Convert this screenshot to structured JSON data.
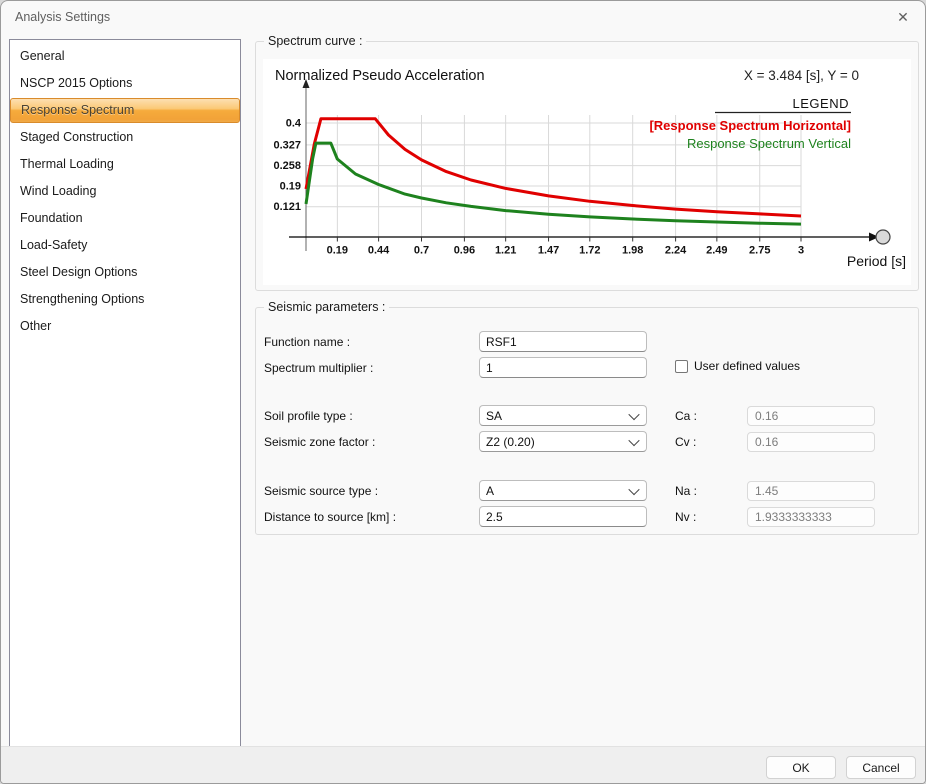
{
  "window": {
    "title": "Analysis Settings",
    "close_icon": "✕"
  },
  "sidebar": {
    "items": [
      {
        "label": "General",
        "selected": false
      },
      {
        "label": "NSCP 2015 Options",
        "selected": false
      },
      {
        "label": "Response Spectrum",
        "selected": true
      },
      {
        "label": "Staged Construction",
        "selected": false
      },
      {
        "label": "Thermal Loading",
        "selected": false
      },
      {
        "label": "Wind Loading",
        "selected": false
      },
      {
        "label": "Foundation",
        "selected": false
      },
      {
        "label": "Load-Safety",
        "selected": false
      },
      {
        "label": "Steel Design Options",
        "selected": false
      },
      {
        "label": "Strengthening Options",
        "selected": false
      },
      {
        "label": "Other",
        "selected": false
      }
    ]
  },
  "spectrum_group": {
    "title": "Spectrum curve :"
  },
  "chart_data": {
    "type": "line",
    "title": "Normalized Pseudo Acceleration",
    "cursor_readout": "X = 3.484 [s],  Y = 0",
    "legend_title": "LEGEND",
    "xlabel": "Period [s]",
    "ylabel": "Normalized Pseudo Acceleration",
    "xlim": [
      0,
      3.3
    ],
    "ylim": [
      0,
      0.48
    ],
    "grid": true,
    "legend_position": "top-right",
    "x_ticks": {
      "values": [
        0.19,
        0.44,
        0.7,
        0.96,
        1.21,
        1.47,
        1.72,
        1.98,
        2.24,
        2.49,
        2.75,
        3
      ],
      "labels": [
        "0.19",
        "0.44",
        "0.7",
        "0.96",
        "1.21",
        "1.47",
        "1.72",
        "1.98",
        "2.24",
        "2.49",
        "2.75",
        "3"
      ]
    },
    "y_ticks": {
      "values": [
        0.4,
        0.327,
        0.258,
        0.19,
        0.121
      ],
      "labels": [
        "0.4",
        "0.327",
        "0.258",
        "0.19",
        "0.121"
      ]
    },
    "series": [
      {
        "name": "[Response Spectrum Horizontal]",
        "color": "#e00000",
        "bold": true,
        "points": [
          [
            0,
            0.18
          ],
          [
            0.05,
            0.33
          ],
          [
            0.09,
            0.414
          ],
          [
            0.42,
            0.414
          ],
          [
            0.5,
            0.36
          ],
          [
            0.6,
            0.312
          ],
          [
            0.7,
            0.277
          ],
          [
            0.85,
            0.238
          ],
          [
            1,
            0.21
          ],
          [
            1.21,
            0.182
          ],
          [
            1.47,
            0.157
          ],
          [
            1.72,
            0.139
          ],
          [
            1.98,
            0.125
          ],
          [
            2.24,
            0.113
          ],
          [
            2.49,
            0.104
          ],
          [
            2.75,
            0.097
          ],
          [
            3,
            0.09
          ]
        ]
      },
      {
        "name": "Response Spectrum Vertical",
        "color": "#1e821e",
        "bold": false,
        "points": [
          [
            0,
            0.13
          ],
          [
            0.04,
            0.28
          ],
          [
            0.06,
            0.333
          ],
          [
            0.15,
            0.333
          ],
          [
            0.19,
            0.28
          ],
          [
            0.3,
            0.23
          ],
          [
            0.44,
            0.195
          ],
          [
            0.6,
            0.163
          ],
          [
            0.7,
            0.15
          ],
          [
            0.85,
            0.134
          ],
          [
            1,
            0.122
          ],
          [
            1.21,
            0.108
          ],
          [
            1.47,
            0.096
          ],
          [
            1.72,
            0.087
          ],
          [
            1.98,
            0.08
          ],
          [
            2.24,
            0.074
          ],
          [
            2.49,
            0.07
          ],
          [
            2.75,
            0.066
          ],
          [
            3,
            0.063
          ]
        ]
      }
    ]
  },
  "seismic_group": {
    "title": "Seismic parameters :",
    "function_name": {
      "label": "Function name :",
      "value": "RSF1"
    },
    "spectrum_multiplier": {
      "label": "Spectrum multiplier :",
      "value": "1"
    },
    "user_defined_values": {
      "label": "User defined values",
      "checked": false
    },
    "soil_profile_type": {
      "label": "Soil profile type :",
      "value": "SA"
    },
    "seismic_zone_factor": {
      "label": "Seismic zone factor :",
      "value": "Z2 (0.20)"
    },
    "ca": {
      "label": "Ca :",
      "value": "0.16"
    },
    "cv": {
      "label": "Cv :",
      "value": "0.16"
    },
    "seismic_source_type": {
      "label": "Seismic source type :",
      "value": "A"
    },
    "distance_to_source": {
      "label": "Distance to source [km] :",
      "value": "2.5"
    },
    "na": {
      "label": "Na :",
      "value": "1.45"
    },
    "nv": {
      "label": "Nv :",
      "value": "1.9333333333"
    }
  },
  "footer": {
    "ok_label": "OK",
    "cancel_label": "Cancel"
  }
}
